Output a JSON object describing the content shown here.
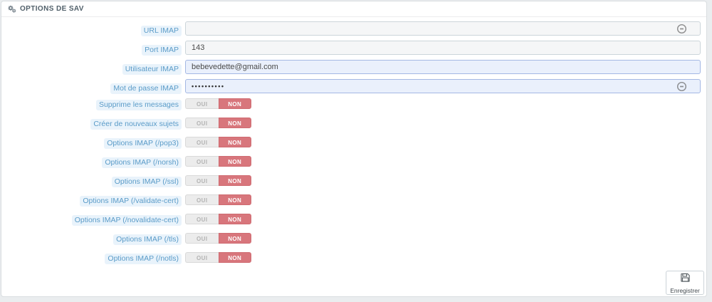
{
  "panel": {
    "title": "OPTIONS DE SAV",
    "icon": "cogs-icon"
  },
  "form": {
    "text_fields": [
      {
        "label": "URL IMAP",
        "value": "",
        "masked": false,
        "autofill": false,
        "trailing_icon": true
      },
      {
        "label": "Port IMAP",
        "value": "143",
        "masked": false,
        "autofill": false,
        "trailing_icon": false
      },
      {
        "label": "Utilisateur IMAP",
        "value": "bebevedette@gmail.com",
        "masked": false,
        "autofill": true,
        "trailing_icon": false
      },
      {
        "label": "Mot de passe IMAP",
        "value": "••••••••••",
        "masked": true,
        "autofill": true,
        "trailing_icon": true
      }
    ],
    "switch_fields": [
      {
        "label": "Supprime les messages",
        "selected": "NON"
      },
      {
        "label": "Créer de nouveaux sujets",
        "selected": "NON"
      },
      {
        "label": "Options IMAP (/pop3)",
        "selected": "NON"
      },
      {
        "label": "Options IMAP (/norsh)",
        "selected": "NON"
      },
      {
        "label": "Options IMAP (/ssl)",
        "selected": "NON"
      },
      {
        "label": "Options IMAP (/validate-cert)",
        "selected": "NON"
      },
      {
        "label": "Options IMAP (/novalidate-cert)",
        "selected": "NON"
      },
      {
        "label": "Options IMAP (/tls)",
        "selected": "NON"
      },
      {
        "label": "Options IMAP (/notls)",
        "selected": "NON"
      }
    ],
    "switch_options": {
      "yes": "OUI",
      "no": "NON"
    }
  },
  "toolbar": {
    "save_label": "Enregistrer",
    "save_icon": "floppy-disk-icon"
  },
  "colors": {
    "page_bg": "#eaedef",
    "panel_bg": "#ffffff",
    "label_text": "#5a9bc8",
    "label_bg": "#e9f3fb",
    "switch_on_bg": "#ececec",
    "switch_off_bg": "#d8767c",
    "autofill_bg": "#eaf0fc",
    "autofill_border": "#a4b8e4"
  }
}
